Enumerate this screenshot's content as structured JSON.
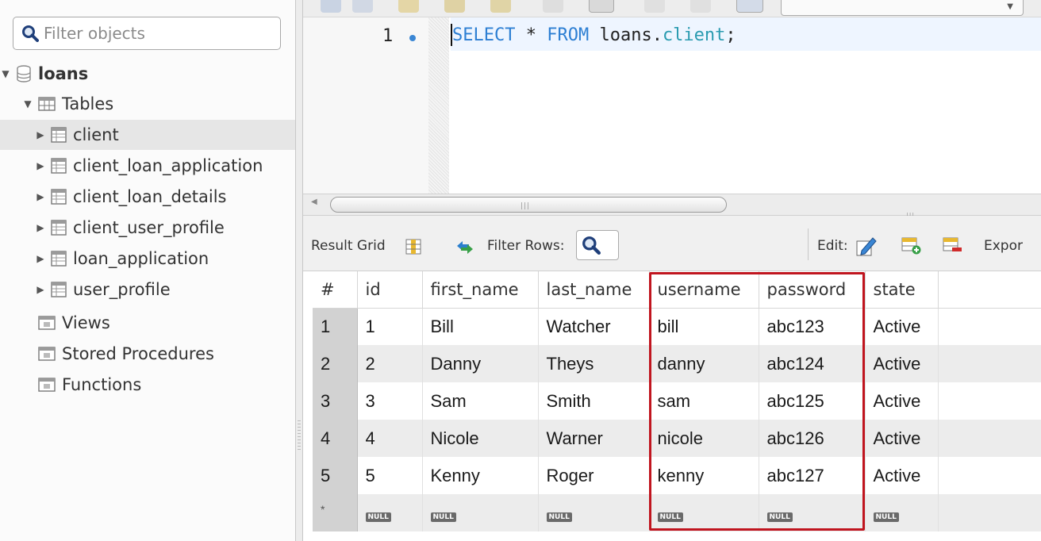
{
  "navigator": {
    "filter_placeholder": "Filter objects",
    "schema": "loans",
    "tables_label": "Tables",
    "tables": [
      "client",
      "client_loan_application",
      "client_loan_details",
      "client_user_profile",
      "loan_application",
      "user_profile"
    ],
    "selected_table": "client",
    "views_label": "Views",
    "stored_procedures_label": "Stored Procedures",
    "functions_label": "Functions"
  },
  "editor": {
    "line_number": "1",
    "sql": {
      "kw1": "SELECT",
      "star": " * ",
      "kw2": "FROM",
      "schema": " loans.",
      "table": "client",
      "end": ";"
    }
  },
  "result_toolbar": {
    "result_grid_label": "Result Grid",
    "filter_rows_label": "Filter Rows:",
    "edit_label": "Edit:",
    "export_label": "Expor"
  },
  "grid": {
    "columns": [
      "#",
      "id",
      "first_name",
      "last_name",
      "username",
      "password",
      "state"
    ],
    "rows": [
      [
        "1",
        "1",
        "Bill",
        "Watcher",
        "bill",
        "abc123",
        "Active"
      ],
      [
        "2",
        "2",
        "Danny",
        "Theys",
        "danny",
        "abc124",
        "Active"
      ],
      [
        "3",
        "3",
        "Sam",
        "Smith",
        "sam",
        "abc125",
        "Active"
      ],
      [
        "4",
        "4",
        "Nicole",
        "Warner",
        "nicole",
        "abc126",
        "Active"
      ],
      [
        "5",
        "5",
        "Kenny",
        "Roger",
        "kenny",
        "abc127",
        "Active"
      ]
    ],
    "new_row_marker": "*",
    "null_label": "NULL"
  },
  "colors": {
    "highlight": "#c0151f",
    "keyword": "#2d7fd3",
    "selected_row": "#e6e6e6"
  }
}
